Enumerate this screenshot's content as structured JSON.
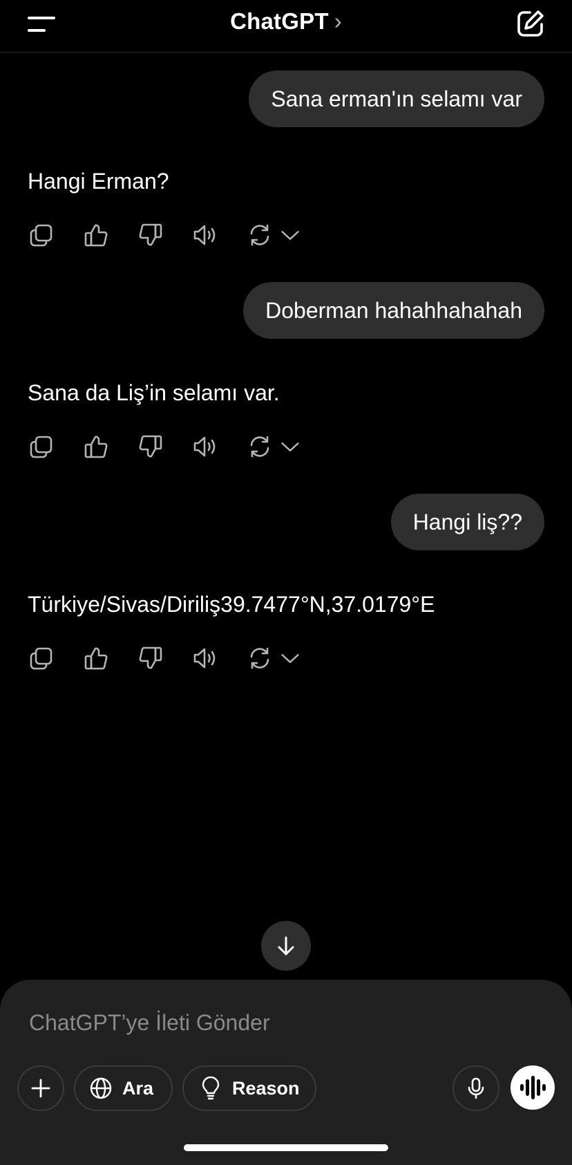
{
  "header": {
    "title": "ChatGPT",
    "chevron": "›",
    "menu_icon": "hamburger-icon",
    "new_chat_icon": "edit-icon"
  },
  "messages": [
    {
      "role": "user",
      "text": "Sana erman'ın selamı var"
    },
    {
      "role": "assistant",
      "text": "Hangi Erman?"
    },
    {
      "role": "user",
      "text": "Doberman hahahhahahah"
    },
    {
      "role": "assistant",
      "text": "Sana da Liş’in selamı var."
    },
    {
      "role": "user",
      "text": "Hangi liş??"
    },
    {
      "role": "assistant",
      "text": "Türkiye/Sivas/Diriliş39.7477°N,37.0179°E"
    }
  ],
  "message_actions": [
    "copy-icon",
    "thumbs-up-icon",
    "thumbs-down-icon",
    "speaker-icon",
    "regenerate-icon",
    "chevron-down-icon"
  ],
  "composer": {
    "placeholder": "ChatGPT’ye İleti Gönder",
    "ara_label": "Ara",
    "reason_label": "Reason"
  },
  "colors": {
    "background": "#000000",
    "bubble": "#2f2f2f",
    "composer": "#212121",
    "placeholder": "#8a8a8a"
  }
}
